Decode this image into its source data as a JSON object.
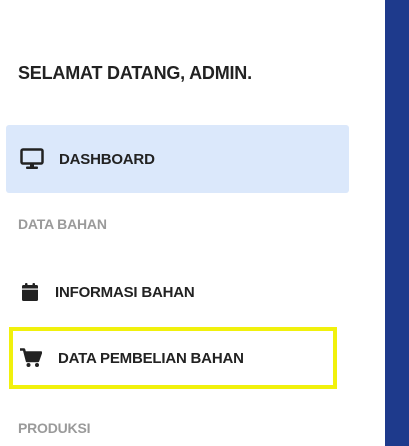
{
  "sidebar": {
    "welcome": "SELAMAT DATANG, ADMIN.",
    "items": [
      {
        "label": "DASHBOARD",
        "icon": "monitor-icon",
        "active": true
      },
      {
        "label": "INFORMASI BAHAN",
        "icon": "calendar-icon",
        "active": false
      },
      {
        "label": "DATA PEMBELIAN BAHAN",
        "icon": "cart-icon",
        "active": false,
        "highlighted": true
      }
    ],
    "sections": {
      "bahan": "DATA BAHAN",
      "produksi": "PRODUKSI"
    }
  },
  "colors": {
    "active_bg": "#dbe8fb",
    "highlight_border": "#f1f10c",
    "main_panel": "#1e3a8c",
    "section_text": "#9a9a9a"
  }
}
